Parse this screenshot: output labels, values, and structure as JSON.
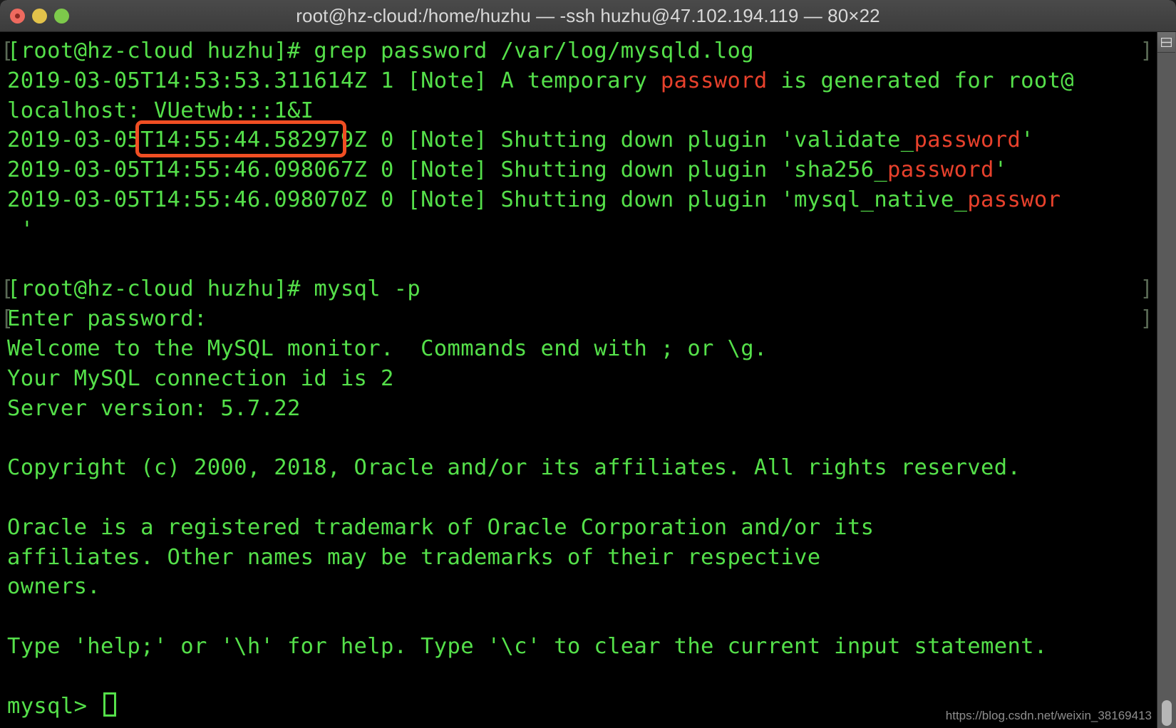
{
  "window": {
    "title": "root@hz-cloud:/home/huzhu — -ssh huzhu@47.102.194.119 — 80×22",
    "traffic_lights": {
      "close_label": "close",
      "minimize_label": "minimize",
      "zoom_label": "zoom"
    },
    "columns": 80,
    "rows": 22
  },
  "colors": {
    "foreground": "#55e04a",
    "background": "#000000",
    "grep_match": "#e8412c",
    "highlight_box": "#f04e23",
    "titlebar": "#3c3c3c",
    "prompt_marker": "#5a6a55"
  },
  "terminal": {
    "prompt": "[root@hz-cloud huzhu]# ",
    "highlighted_password": "VUetwb:::1&I",
    "lines": [
      {
        "id": "cmd-grep",
        "marker_left": "[",
        "marker_right": "]",
        "segments": [
          {
            "text": "[root@hz-cloud huzhu]# grep password /var/log/mysqld.log",
            "match": false
          }
        ]
      },
      {
        "id": "log-temp-password-1",
        "segments": [
          {
            "text": "2019-03-05T14:53:53.311614Z 1 [Note] A temporary ",
            "match": false
          },
          {
            "text": "password",
            "match": true
          },
          {
            "text": " is generated for root@",
            "match": false
          }
        ]
      },
      {
        "id": "log-temp-password-2",
        "segments": [
          {
            "text": "localhost: VUetwb:::1&I",
            "match": false
          }
        ]
      },
      {
        "id": "log-validate-password",
        "segments": [
          {
            "text": "2019-03-05T14:55:44.582979Z 0 [Note] Shutting down plugin 'validate_",
            "match": false
          },
          {
            "text": "password",
            "match": true
          },
          {
            "text": "'",
            "match": false
          }
        ]
      },
      {
        "id": "log-sha256-password",
        "segments": [
          {
            "text": "2019-03-05T14:55:46.098067Z 0 [Note] Shutting down plugin 'sha256_",
            "match": false
          },
          {
            "text": "password",
            "match": true
          },
          {
            "text": "'",
            "match": false
          }
        ]
      },
      {
        "id": "log-native-password",
        "segments": [
          {
            "text": "2019-03-05T14:55:46.098070Z 0 [Note] Shutting down plugin 'mysql_native_",
            "match": false
          },
          {
            "text": "passwor",
            "match": true
          }
        ]
      },
      {
        "id": "log-native-password-wrap",
        "segments": [
          {
            "text": " '",
            "match": false
          }
        ]
      },
      {
        "id": "blank-1",
        "segments": [
          {
            "text": " ",
            "match": false
          }
        ]
      },
      {
        "id": "cmd-mysql",
        "marker_left": "[",
        "marker_right": "]",
        "segments": [
          {
            "text": "[root@hz-cloud huzhu]# mysql -p",
            "match": false
          }
        ]
      },
      {
        "id": "enter-password",
        "marker_left": "[",
        "marker_right": "]",
        "segments": [
          {
            "text": "Enter password:",
            "match": false
          }
        ]
      },
      {
        "id": "welcome",
        "segments": [
          {
            "text": "Welcome to the MySQL monitor.  Commands end with ; or \\g.",
            "match": false
          }
        ]
      },
      {
        "id": "connection-id",
        "segments": [
          {
            "text": "Your MySQL connection id is 2",
            "match": false
          }
        ]
      },
      {
        "id": "server-version",
        "segments": [
          {
            "text": "Server version: 5.7.22",
            "match": false
          }
        ]
      },
      {
        "id": "blank-2",
        "segments": [
          {
            "text": " ",
            "match": false
          }
        ]
      },
      {
        "id": "copyright",
        "segments": [
          {
            "text": "Copyright (c) 2000, 2018, Oracle and/or its affiliates. All rights reserved.",
            "match": false
          }
        ]
      },
      {
        "id": "blank-3",
        "segments": [
          {
            "text": " ",
            "match": false
          }
        ]
      },
      {
        "id": "trademark-1",
        "segments": [
          {
            "text": "Oracle is a registered trademark of Oracle Corporation and/or its",
            "match": false
          }
        ]
      },
      {
        "id": "trademark-2",
        "segments": [
          {
            "text": "affiliates. Other names may be trademarks of their respective",
            "match": false
          }
        ]
      },
      {
        "id": "trademark-3",
        "segments": [
          {
            "text": "owners.",
            "match": false
          }
        ]
      },
      {
        "id": "blank-4",
        "segments": [
          {
            "text": " ",
            "match": false
          }
        ]
      },
      {
        "id": "help-hint",
        "segments": [
          {
            "text": "Type 'help;' or '\\h' for help. Type '\\c' to clear the current input statement.",
            "match": false
          }
        ]
      },
      {
        "id": "blank-5",
        "segments": [
          {
            "text": " ",
            "match": false
          }
        ]
      }
    ],
    "mysql_prompt": "mysql> ",
    "cursor": "block-cursor"
  },
  "scrollbar": {
    "split_pane_icon": "split-pane-icon",
    "thumb_label": "scrollbar-thumb"
  },
  "watermark": {
    "text": "https://blog.csdn.net/weixin_38169413"
  }
}
